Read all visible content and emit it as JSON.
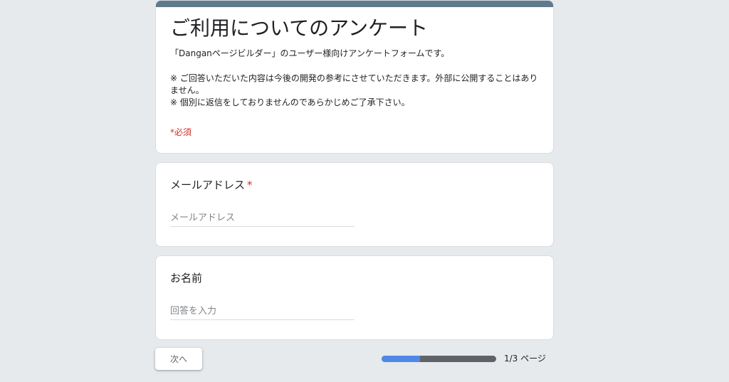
{
  "form": {
    "title": "ご利用についてのアンケート",
    "description_line1": "「Danganページビルダー」のユーザー様向けアンケートフォームです。",
    "description_line2": "※ ご回答いただいた内容は今後の開発の参考にさせていただきます。外部に公開することはありません。",
    "description_line3": "※ 個別に返信をしておりませんのであらかじめご了承下さい。",
    "required_note": "*必須",
    "accent_color": "#5f7a8a",
    "required_color": "#d93025"
  },
  "questions": [
    {
      "title": "メールアドレス",
      "required_mark": "*",
      "placeholder": "メールアドレス",
      "value": ""
    },
    {
      "title": "お名前",
      "placeholder": "回答を入力",
      "value": ""
    }
  ],
  "footer": {
    "next_label": "次へ",
    "progress_text": "1/3 ページ",
    "progress_fraction": 0.333,
    "progress_fill_color": "#4e89e8",
    "progress_track_color": "#5f6368"
  }
}
